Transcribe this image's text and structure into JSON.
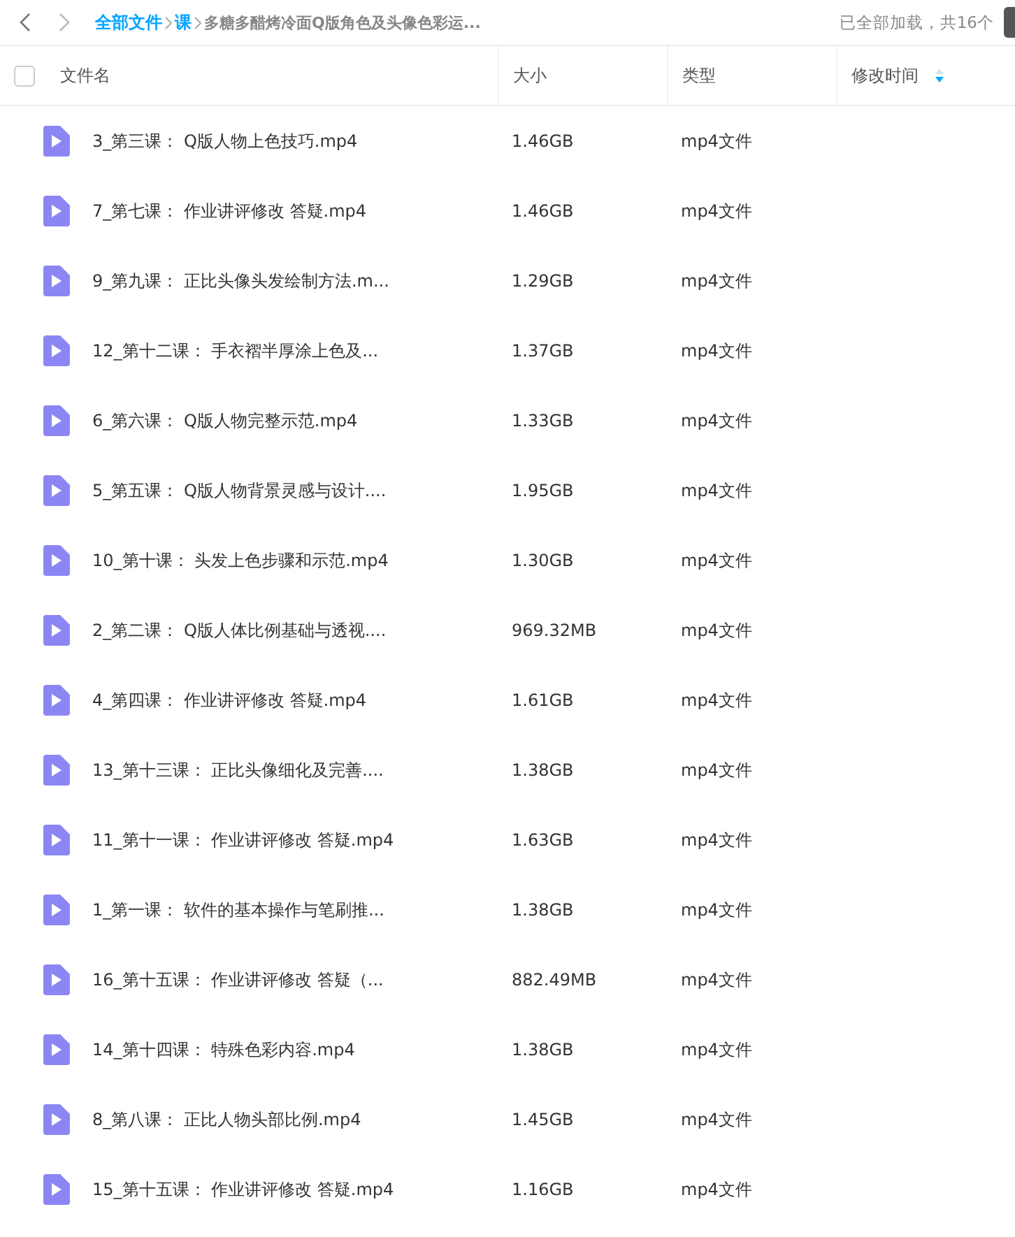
{
  "breadcrumb": [
    {
      "label": "全部文件",
      "kind": "link"
    },
    {
      "label": "课",
      "kind": "link"
    },
    {
      "label": "多糖多醋烤冷面Q版角色及头像色彩运...",
      "kind": "current"
    }
  ],
  "status": "已全部加载，共16个",
  "header": {
    "checked": false,
    "columns": [
      {
        "label": "文件名",
        "sorted": false
      },
      {
        "label": "大小",
        "sorted": false
      },
      {
        "label": "类型",
        "sorted": false
      },
      {
        "label": "修改时间",
        "sorted": true
      }
    ]
  },
  "rows": [
    {
      "name": "3_第三课： Q版人物上色技巧.mp4",
      "size": "1.46GB",
      "type": "mp4文件"
    },
    {
      "name": "7_第七课： 作业讲评修改 答疑.mp4",
      "size": "1.46GB",
      "type": "mp4文件"
    },
    {
      "name": "9_第九课： 正比头像头发绘制方法.m...",
      "size": "1.29GB",
      "type": "mp4文件"
    },
    {
      "name": "12_第十二课： 手衣褶半厚涂上色及...",
      "size": "1.37GB",
      "type": "mp4文件"
    },
    {
      "name": "6_第六课： Q版人物完整示范.mp4",
      "size": "1.33GB",
      "type": "mp4文件"
    },
    {
      "name": "5_第五课： Q版人物背景灵感与设计....",
      "size": "1.95GB",
      "type": "mp4文件"
    },
    {
      "name": "10_第十课： 头发上色步骤和示范.mp4",
      "size": "1.30GB",
      "type": "mp4文件"
    },
    {
      "name": "2_第二课： Q版人体比例基础与透视....",
      "size": "969.32MB",
      "type": "mp4文件"
    },
    {
      "name": "4_第四课： 作业讲评修改 答疑.mp4",
      "size": "1.61GB",
      "type": "mp4文件"
    },
    {
      "name": "13_第十三课： 正比头像细化及完善....",
      "size": "1.38GB",
      "type": "mp4文件"
    },
    {
      "name": "11_第十一课： 作业讲评修改 答疑.mp4",
      "size": "1.63GB",
      "type": "mp4文件"
    },
    {
      "name": "1_第一课： 软件的基本操作与笔刷推...",
      "size": "1.38GB",
      "type": "mp4文件"
    },
    {
      "name": "16_第十五课： 作业讲评修改 答疑（...",
      "size": "882.49MB",
      "type": "mp4文件"
    },
    {
      "name": "14_第十四课： 特殊色彩内容.mp4",
      "size": "1.38GB",
      "type": "mp4文件"
    },
    {
      "name": "8_第八课： 正比人物头部比例.mp4",
      "size": "1.45GB",
      "type": "mp4文件"
    },
    {
      "name": "15_第十五课： 作业讲评修改 答疑.mp4",
      "size": "1.16GB",
      "type": "mp4文件"
    }
  ]
}
